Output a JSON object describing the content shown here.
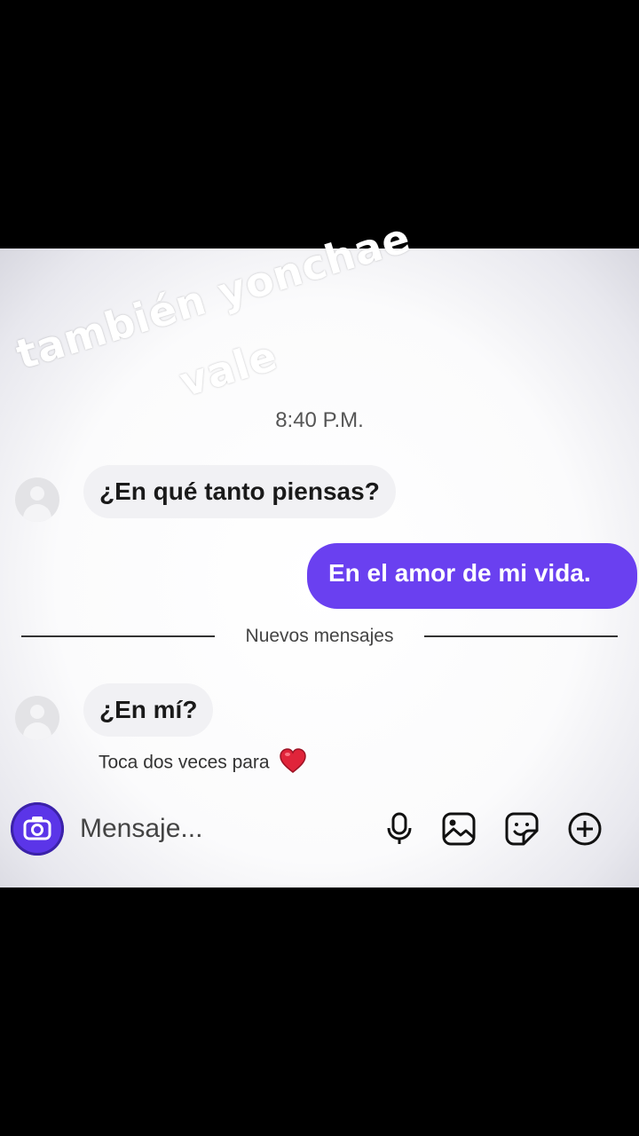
{
  "overlay": {
    "line1": "también yonchae",
    "line2": "vale"
  },
  "chat": {
    "timestamp": "8:40 P.M.",
    "messages": [
      {
        "direction": "incoming",
        "text": "¿En qué tanto piensas?"
      },
      {
        "direction": "outgoing",
        "text": "En el amor de mi vida."
      },
      {
        "direction": "incoming",
        "text": "¿En mí?"
      }
    ],
    "divider_label": "Nuevos mensajes",
    "hint": "Toca dos veces para"
  },
  "composer": {
    "placeholder": "Mensaje...",
    "icons": [
      "camera-icon",
      "microphone-icon",
      "gallery-icon",
      "sticker-icon",
      "add-icon"
    ]
  },
  "colors": {
    "accent": "#6a40f0",
    "heart": "#e0243a"
  }
}
